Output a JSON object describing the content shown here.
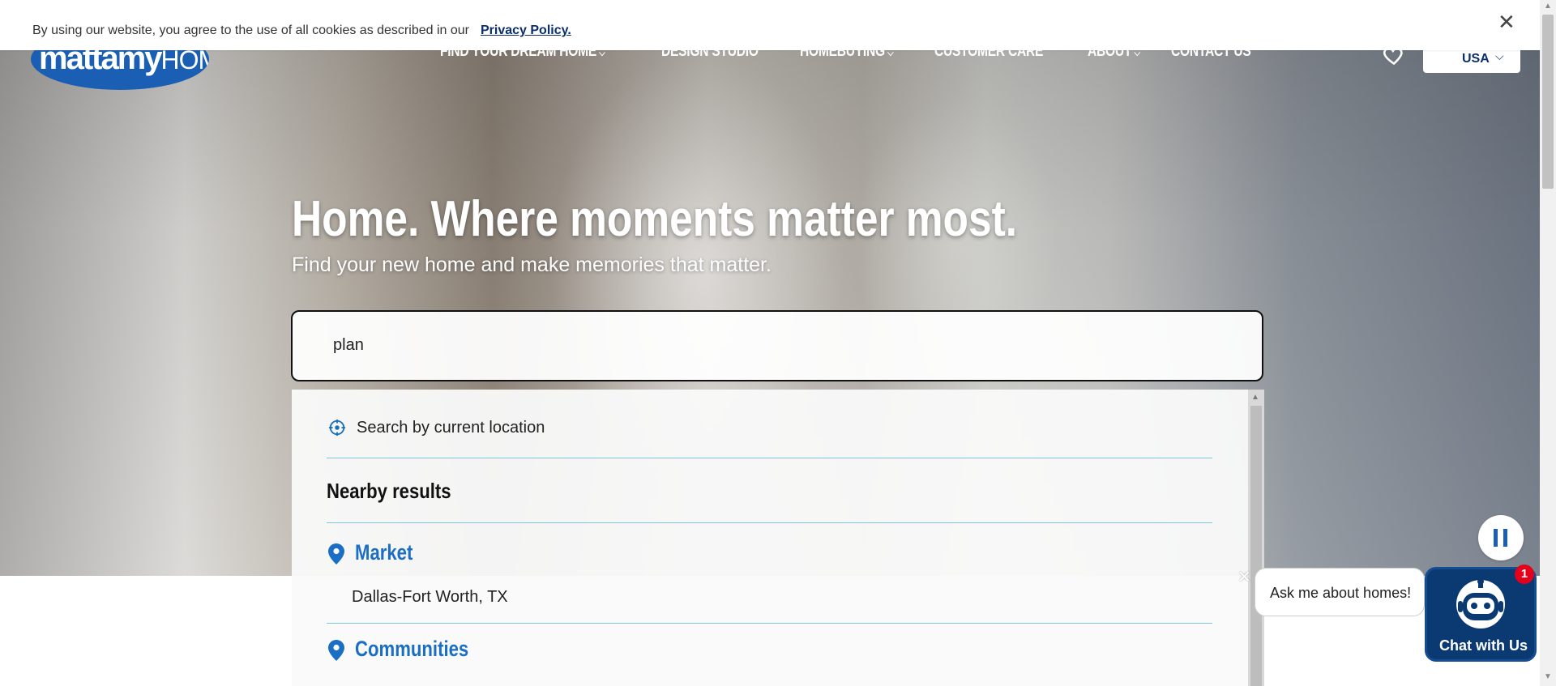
{
  "cookie_banner": {
    "text": "By using our website, you agree to the use of all cookies as described in our",
    "link_label": "Privacy Policy.",
    "close_glyph": "✕"
  },
  "header": {
    "logo": {
      "main": "mattamy",
      "sub": "HOMES"
    },
    "nav": [
      {
        "label": "FIND YOUR DREAM HOME",
        "has_dropdown": true
      },
      {
        "label": "DESIGN STUDIO",
        "has_dropdown": false
      },
      {
        "label": "HOMEBUYING",
        "has_dropdown": true
      },
      {
        "label": "CUSTOMER CARE",
        "has_dropdown": false
      },
      {
        "label": "ABOUT",
        "has_dropdown": true
      },
      {
        "label": "CONTACT US",
        "has_dropdown": false
      }
    ],
    "favorites_icon": "heart-icon",
    "country_selector": "USA"
  },
  "hero": {
    "headline": "Home. Where moments matter most.",
    "subheadline": "Find your new home and make memories that matter."
  },
  "search": {
    "value": "plan",
    "current_location_label": "Search by current location",
    "nearby_heading": "Nearby results",
    "groups": [
      {
        "category": "Market",
        "results": [
          "Dallas-Fort Worth, TX"
        ]
      },
      {
        "category": "Communities",
        "results": []
      }
    ]
  },
  "chat": {
    "bubble_text": "Ask me about homes!",
    "button_label": "Chat with Us",
    "badge_count": "1"
  },
  "colors": {
    "brand_blue": "#1a5fb4",
    "link_blue": "#1a6fc4",
    "navy": "#0b3a73",
    "divider": "#7cc6d6",
    "badge_red": "#e4001b"
  }
}
